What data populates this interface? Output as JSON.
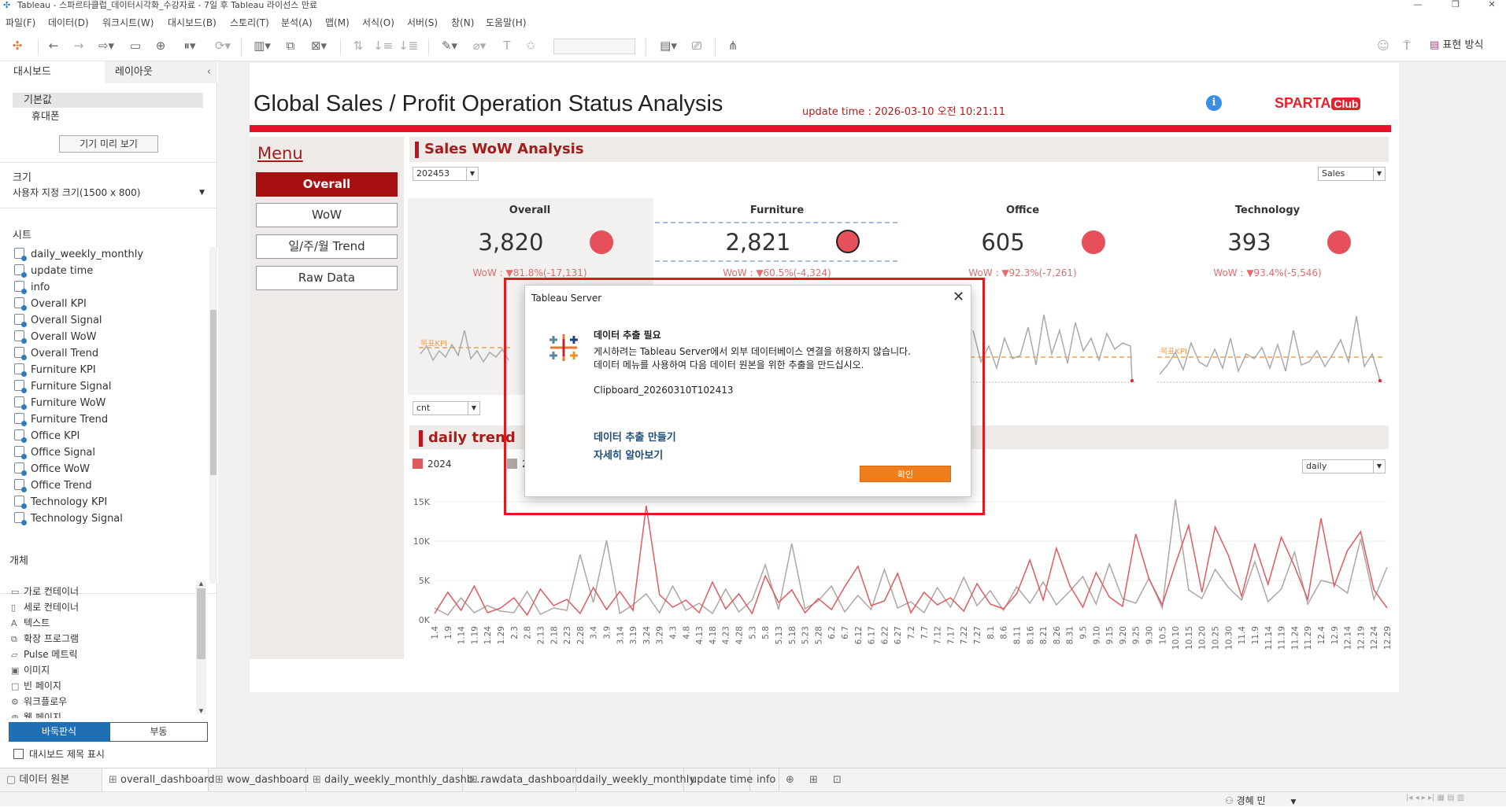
{
  "window": {
    "title": "Tableau - 스파르타클럽_데이터시각화_수강자료 - 7일 후 Tableau 라이선스 만료"
  },
  "menu": [
    "파일(F)",
    "데이터(D)",
    "워크시트(W)",
    "대시보드(B)",
    "스토리(T)",
    "분석(A)",
    "맵(M)",
    "서식(O)",
    "서버(S)",
    "창(N)",
    "도움말(H)"
  ],
  "toolbar": {
    "show_me": "표현 방식"
  },
  "left_pane": {
    "tabs": [
      "대시보드",
      "레이아웃"
    ],
    "device_default": "기본값",
    "device_phone": "휴대폰",
    "preview_button": "기기 미리 보기",
    "size_heading": "크기",
    "size_value": "사용자 지정 크기(1500 x 800)",
    "sheets_heading": "시트",
    "sheets": [
      "daily_weekly_monthly",
      "update time",
      "info",
      "Overall KPI",
      "Overall Signal",
      "Overall WoW",
      "Overall Trend",
      "Furniture KPI",
      "Furniture Signal",
      "Furniture WoW",
      "Furniture Trend",
      "Office KPI",
      "Office Signal",
      "Office WoW",
      "Office Trend",
      "Technology KPI",
      "Technology Signal"
    ],
    "objects_heading": "개체",
    "objects": [
      {
        "icon": "horizontal-container-icon",
        "glyph": "▭",
        "label": "가로 컨테이너"
      },
      {
        "icon": "vertical-container-icon",
        "glyph": "▯",
        "label": "세로 컨테이너"
      },
      {
        "icon": "text-icon",
        "glyph": "A",
        "label": "텍스트"
      },
      {
        "icon": "extension-icon",
        "glyph": "⧉",
        "label": "확장 프로그램"
      },
      {
        "icon": "pulse-metric-icon",
        "glyph": "▱",
        "label": "Pulse 메트릭"
      },
      {
        "icon": "image-icon",
        "glyph": "▣",
        "label": "이미지"
      },
      {
        "icon": "blank-page-icon",
        "glyph": "□",
        "label": "빈 페이지"
      },
      {
        "icon": "workflow-icon",
        "glyph": "⚙",
        "label": "워크플로우"
      },
      {
        "icon": "web-page-icon",
        "glyph": "◍",
        "label": "웹 페이지"
      }
    ],
    "tiled_button": "바둑판식",
    "floating_button": "부동",
    "show_title_label": "대시보드 제목 표시"
  },
  "dashboard": {
    "title": "Global Sales / Profit Operation Status Analysis",
    "update_time": "update time : 2026-03-10 오전 10:21:11",
    "brand": "SPARTA",
    "brand_suffix": "Club",
    "menu_heading": "Menu",
    "menu_buttons": [
      "Overall",
      "WoW",
      "일/주/월 Trend",
      "Raw Data"
    ],
    "wow_section_title": "Sales WoW Analysis",
    "week_filter": "202453",
    "measure_filter": "Sales",
    "kpis": [
      {
        "name": "Overall",
        "value": "3,820",
        "wow": "WoW : ▼81.8%(-17,131)"
      },
      {
        "name": "Furniture",
        "value": "2,821",
        "wow": "WoW : ▼60.5%(-4,324)"
      },
      {
        "name": "Office",
        "value": "605",
        "wow": "WoW : ▼92.3%(-7,261)"
      },
      {
        "name": "Technology",
        "value": "393",
        "wow": "WoW : ▼93.4%(-5,546)"
      }
    ],
    "kpi_reference_label": "목표KPI",
    "cnt_filter": "cnt",
    "trend_section_title": "daily trend",
    "legend": [
      "2024",
      "2023"
    ],
    "granularity_filter": "daily"
  },
  "dialog": {
    "window_title": "Tableau Server",
    "heading": "데이터 추출 필요",
    "message_line1": "게시하려는 Tableau Server에서 외부 데이터베이스 연결을 허용하지 않습니다.",
    "message_line2": "데이터 메뉴를 사용하여 다음 데이터 원본을 위한 추출을 만드십시오.",
    "datasource": "Clipboard_20260310T102413",
    "link_create": "데이터 추출 만들기",
    "link_learn": "자세히 알아보기",
    "ok_button": "확인"
  },
  "sheet_tabs": [
    "데이터 원본",
    "overall_dashboard",
    "wow_dashboard",
    "daily_weekly_monthly_dashb...",
    "rawdata_dashboard",
    "daily_weekly_monthly",
    "update time",
    "info"
  ],
  "status": {
    "user": "경혜 민"
  },
  "colors": {
    "accent_red": "#c2121f",
    "series_2024": "#e05a5e",
    "series_2023": "#b0a5a3",
    "ok_orange": "#ef7d1b",
    "link_blue": "#1f4e79"
  },
  "chart_data": {
    "type": "line",
    "title": "daily trend",
    "xlabel": "",
    "ylabel": "",
    "y_tick_labels": [
      "0K",
      "5K",
      "10K",
      "15K"
    ],
    "ylim": [
      0,
      17000
    ],
    "grid": true,
    "legend_position": "top-left",
    "categories": [
      "1.4",
      "1.9",
      "1.14",
      "1.19",
      "1.24",
      "1.29",
      "2.3",
      "2.8",
      "2.13",
      "2.18",
      "2.23",
      "2.28",
      "3.4",
      "3.9",
      "3.14",
      "3.19",
      "3.24",
      "3.29",
      "4.3",
      "4.8",
      "4.13",
      "4.18",
      "4.23",
      "4.28",
      "5.3",
      "5.8",
      "5.13",
      "5.18",
      "5.23",
      "5.28",
      "6.2",
      "6.7",
      "6.12",
      "6.17",
      "6.22",
      "6.27",
      "7.2",
      "7.7",
      "7.12",
      "7.17",
      "7.22",
      "7.27",
      "8.1",
      "8.6",
      "8.11",
      "8.16",
      "8.21",
      "8.26",
      "8.31",
      "9.5",
      "9.10",
      "9.15",
      "9.20",
      "9.25",
      "9.30",
      "10.5",
      "10.10",
      "10.15",
      "10.20",
      "10.25",
      "10.30",
      "11.4",
      "11.9",
      "11.14",
      "11.19",
      "11.24",
      "11.29",
      "12.4",
      "12.9",
      "12.14",
      "12.19",
      "12.24",
      "12.29"
    ],
    "series": [
      {
        "name": "2024",
        "values": [
          800,
          3500,
          1200,
          4300,
          900,
          1500,
          2800,
          600,
          3900,
          1800,
          2600,
          800,
          4100,
          1300,
          3600,
          1200,
          14500,
          3200,
          1600,
          2500,
          900,
          4800,
          1400,
          3300,
          800,
          5600,
          2200,
          3800,
          900,
          2700,
          1300,
          4200,
          6800,
          1800,
          2400,
          5900,
          900,
          3500,
          1900,
          2800,
          1100,
          4600,
          2000,
          1400,
          3300,
          7600,
          2500,
          9100,
          4400,
          1600,
          6000,
          2900,
          1700,
          10900,
          5200,
          1900,
          7100,
          12000,
          3500,
          11800,
          8200,
          3000,
          9600,
          4500,
          10500,
          6800,
          2600,
          12900,
          4300,
          8800,
          11200,
          3800,
          1500
        ]
      },
      {
        "name": "2023",
        "values": [
          1500,
          600,
          2800,
          900,
          1800,
          1100,
          900,
          3600,
          700,
          1500,
          1200,
          8300,
          2200,
          10100,
          800,
          1900,
          3300,
          900,
          4300,
          1200,
          2100,
          800,
          3900,
          1000,
          2500,
          7000,
          1300,
          9700,
          1400,
          2400,
          4300,
          1000,
          3100,
          1300,
          6400,
          1500,
          2300,
          900,
          4100,
          1600,
          5400,
          1800,
          3700,
          1200,
          4200,
          2100,
          4800,
          1900,
          3600,
          5500,
          2000,
          7100,
          2700,
          2100,
          5300,
          1500,
          15300,
          3800,
          2700,
          6400,
          4100,
          2500,
          7400,
          2300,
          3900,
          8600,
          2000,
          5000,
          4600,
          3400,
          10300,
          2600,
          6700
        ]
      }
    ]
  }
}
